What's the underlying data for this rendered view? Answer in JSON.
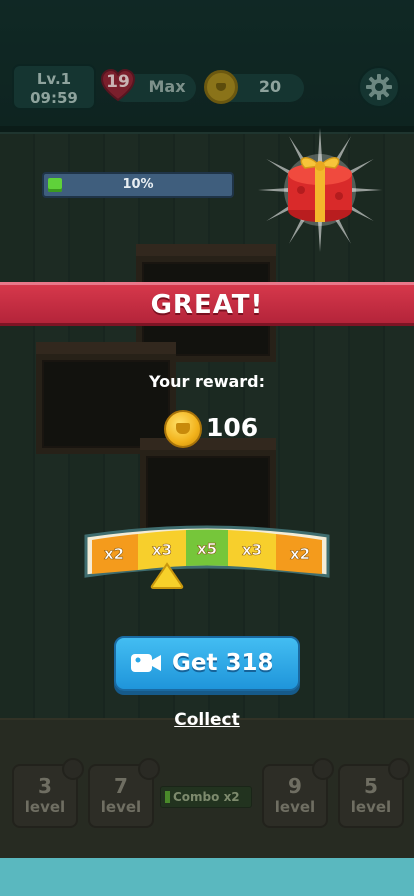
{
  "header": {
    "level_label": "Lv.1",
    "time": "09:59",
    "hearts_count": "19",
    "hearts_status": "Max",
    "coins": "20"
  },
  "progress": {
    "label": "10%",
    "value": 0.1
  },
  "banner": {
    "text": "GREAT!"
  },
  "reward": {
    "label": "Your reward:",
    "amount": "106"
  },
  "multipliers": [
    "x2",
    "x3",
    "x5",
    "x3",
    "x2"
  ],
  "get_button": {
    "label": "Get 318"
  },
  "collect": {
    "label": "Collect"
  },
  "bottom_tiles": [
    {
      "number": "3",
      "label": "level"
    },
    {
      "number": "7",
      "label": "level"
    },
    {
      "number": "9",
      "label": "level"
    },
    {
      "number": "5",
      "label": "level"
    }
  ],
  "combo": {
    "label": "Combo x2"
  },
  "colors": {
    "banner": "#c92e44",
    "button": "#2aa7e6",
    "accent_green": "#5fd13a",
    "coin_gold": "#f2b21b"
  },
  "icons": [
    "heart-icon",
    "coin-icon",
    "gear-icon",
    "gift-icon",
    "video-camera-icon",
    "lock-icon"
  ]
}
